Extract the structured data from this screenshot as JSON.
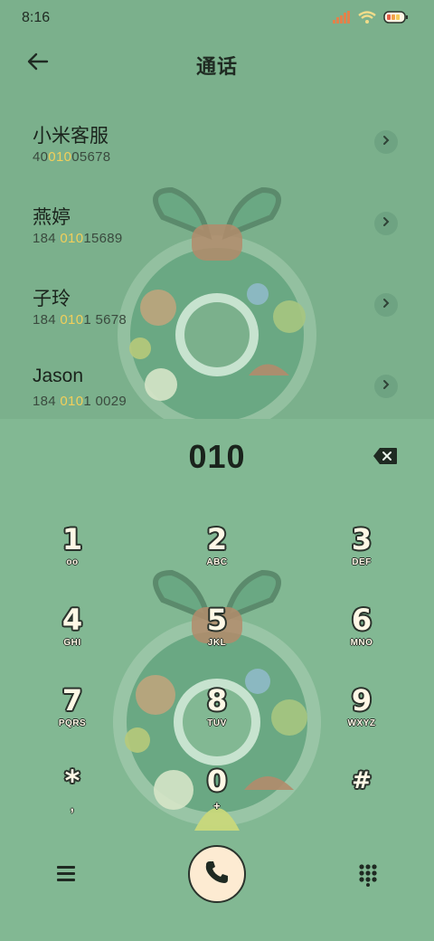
{
  "status_bar": {
    "time": "8:16",
    "icons": [
      "signal-icon",
      "wifi-icon",
      "battery-icon"
    ]
  },
  "header": {
    "title": "通话",
    "back_icon": "arrow-left-icon"
  },
  "contacts": [
    {
      "name": "小米客服",
      "number_pre": "40",
      "number_hl": "010",
      "number_post": "05678"
    },
    {
      "name": "燕婷",
      "number_pre": "184 ",
      "number_hl": "010",
      "number_post": "15689"
    },
    {
      "name": "子玲",
      "number_pre": "184 ",
      "number_hl": "010",
      "number_post": "1 5678"
    },
    {
      "name": "Jason",
      "number_pre": "184 ",
      "number_hl": "010",
      "number_post": "1 0029"
    }
  ],
  "dialer": {
    "input": "010",
    "keys": [
      {
        "digit": "1",
        "sub": "oo"
      },
      {
        "digit": "2",
        "sub": "ABC"
      },
      {
        "digit": "3",
        "sub": "DEF"
      },
      {
        "digit": "4",
        "sub": "GHI"
      },
      {
        "digit": "5",
        "sub": "JKL"
      },
      {
        "digit": "6",
        "sub": "MNO"
      },
      {
        "digit": "7",
        "sub": "PQRS"
      },
      {
        "digit": "8",
        "sub": "TUV"
      },
      {
        "digit": "9",
        "sub": "WXYZ"
      },
      {
        "digit": "*",
        "sub": ","
      },
      {
        "digit": "0",
        "sub": "+"
      },
      {
        "digit": "#",
        "sub": ""
      }
    ]
  },
  "colors": {
    "highlight": "#f2cf5a",
    "top_bg": "#7bb08c",
    "bottom_bg": "#82b893",
    "call_button": "#fdebd2"
  }
}
